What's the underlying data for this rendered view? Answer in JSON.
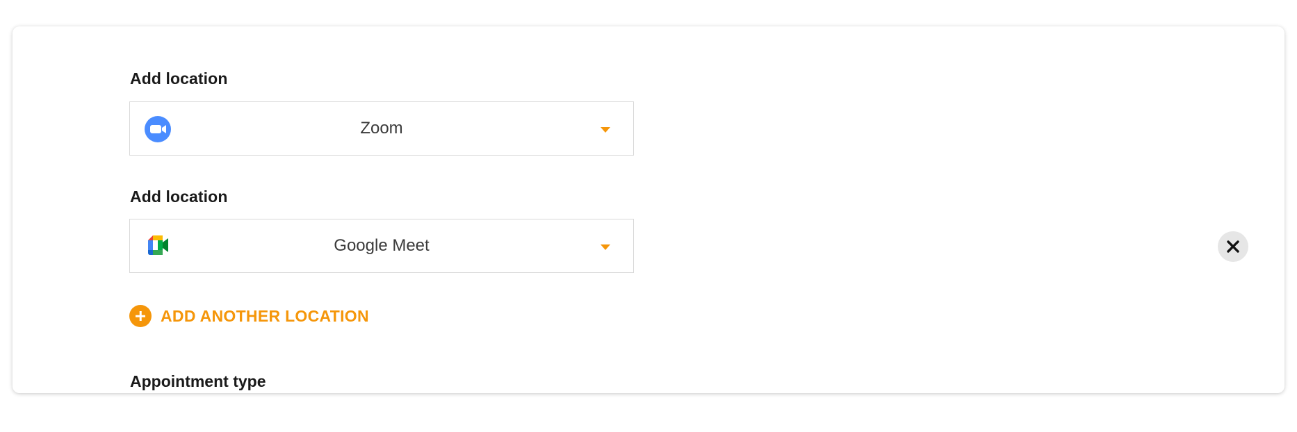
{
  "locations": [
    {
      "label": "Add location",
      "value": "Zoom",
      "icon": "zoom-icon",
      "icon_color": "#4a8cff"
    },
    {
      "label": "Add location",
      "value": "Google Meet",
      "icon": "google-meet-icon"
    }
  ],
  "add_another": {
    "label": "ADD ANOTHER LOCATION",
    "icon": "plus-circle-icon",
    "color": "#f5960a"
  },
  "remove_button": {
    "icon": "close-icon"
  },
  "next_section": {
    "label": "Appointment type"
  },
  "colors": {
    "accent": "#f5960a",
    "border": "#d9d9d9",
    "remove_bg": "#e6e6e6"
  }
}
